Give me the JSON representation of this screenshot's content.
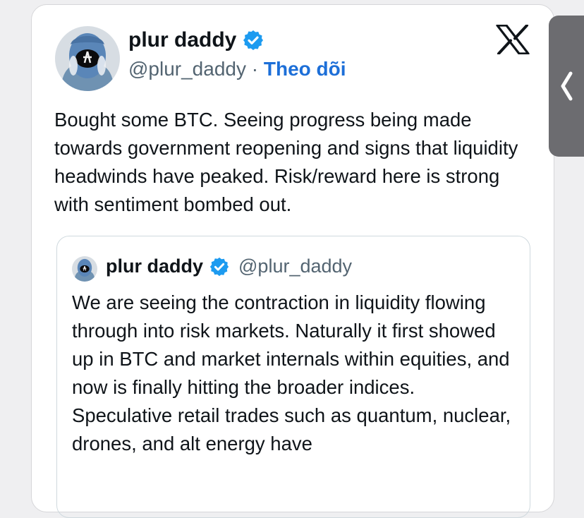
{
  "tweet": {
    "author": {
      "name": "plur daddy",
      "handle": "@plur_daddy",
      "separator": " · ",
      "follow_label": "Theo dõi",
      "avatar_icon": "alien-avatar-icon",
      "verified_icon": "verified-badge-icon"
    },
    "platform_icon": "x-logo-icon",
    "text": "Bought some BTC. Seeing progress being made towards government reopening and signs that liquidity headwinds have peaked. Risk/reward here is strong with sentiment bombed out.",
    "quote": {
      "author_name": "plur daddy",
      "handle": "@plur_daddy",
      "text": "We are seeing the contraction in liquidity flowing through into risk markets. Naturally it first showed up in BTC and market internals within equities, and now is finally hitting the broader indices. Speculative retail trades such as quantum, nuclear, drones, and alt energy have"
    }
  },
  "side_panel": {
    "icon": "chevron-left-icon"
  },
  "colors": {
    "follow": "#1d6fd8",
    "verified": "#1d9bf0",
    "text": "#0f1419",
    "muted": "#536471",
    "side_tab": "#6c6c70"
  }
}
